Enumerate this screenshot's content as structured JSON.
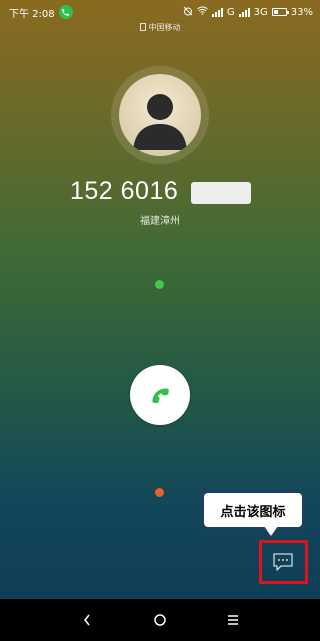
{
  "status_bar": {
    "time": "下午 2:08",
    "network_g": "G",
    "network_3g": "3G",
    "battery_percent": "33%",
    "battery_level": 0.33
  },
  "carrier": "中国移动",
  "call": {
    "number": "152 6016",
    "location": "福建漳州"
  },
  "tooltip": {
    "text": "点击该图标"
  },
  "icons": {
    "call_status": "phone-icon",
    "answer": "phone-answer-icon",
    "message": "message-icon",
    "nav_back": "back-icon",
    "nav_home": "home-icon",
    "nav_menu": "menu-icon"
  },
  "colors": {
    "answer_green": "#2fc04f",
    "decline_orange": "#e5622a",
    "highlight_red": "#e0121a",
    "callout_border": "#1f3f66"
  }
}
